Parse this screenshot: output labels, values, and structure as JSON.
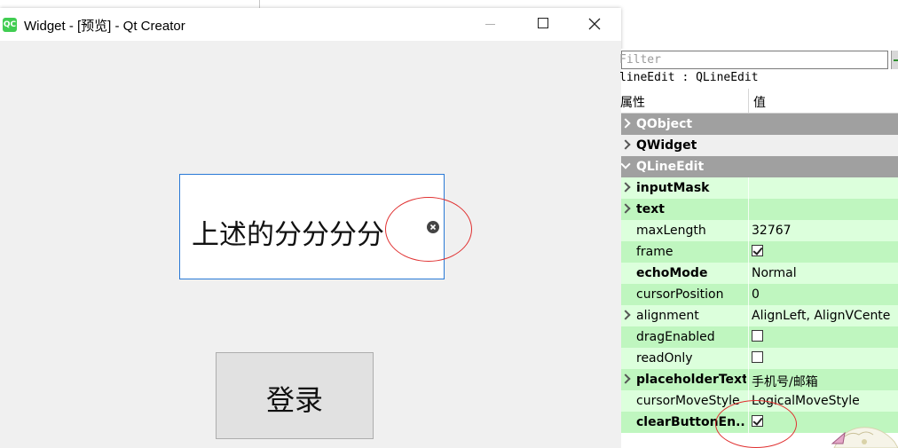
{
  "window": {
    "title": "Widget - [预览] - Qt Creator",
    "logo_text": "QC",
    "controls": [
      "minimize-icon",
      "maximize-icon",
      "close-icon"
    ]
  },
  "form": {
    "input_value": "上述的分分分分",
    "clear_icon": "clear-icon",
    "login_label": "登录"
  },
  "properties": {
    "filter_placeholder": "Filter",
    "object_label": "lineEdit : QLineEdit",
    "header_property": "属性",
    "header_value": "值",
    "rows": [
      {
        "name": "QObject",
        "value": "",
        "type": "group"
      },
      {
        "name": "QWidget",
        "value": "",
        "type": "group-light"
      },
      {
        "name": "QLineEdit",
        "value": "",
        "type": "group-open"
      },
      {
        "name": "inputMask",
        "value": "",
        "type": "bold-expand"
      },
      {
        "name": "text",
        "value": "",
        "type": "bold-expand"
      },
      {
        "name": "maxLength",
        "value": "32767",
        "type": "normal"
      },
      {
        "name": "frame",
        "value": "checked",
        "type": "checkbox"
      },
      {
        "name": "echoMode",
        "value": "Normal",
        "type": "bold"
      },
      {
        "name": "cursorPosition",
        "value": "0",
        "type": "normal"
      },
      {
        "name": "alignment",
        "value": "AlignLeft, AlignVCente",
        "type": "expand"
      },
      {
        "name": "dragEnabled",
        "value": "unchecked",
        "type": "checkbox"
      },
      {
        "name": "readOnly",
        "value": "unchecked",
        "type": "checkbox"
      },
      {
        "name": "placeholderText",
        "value": "手机号/邮箱",
        "type": "bold-expand"
      },
      {
        "name": "cursorMoveStyle",
        "value": "LogicalMoveStyle",
        "type": "normal"
      },
      {
        "name": "clearButtonEn...",
        "value": "checked",
        "type": "bold-checkbox"
      }
    ]
  },
  "colors": {
    "row_light": "#dcffdc",
    "row_dark": "#bff6bf",
    "group_bg": "#a0a0a0",
    "annotation": "#e03030",
    "input_border": "#2979d6"
  }
}
